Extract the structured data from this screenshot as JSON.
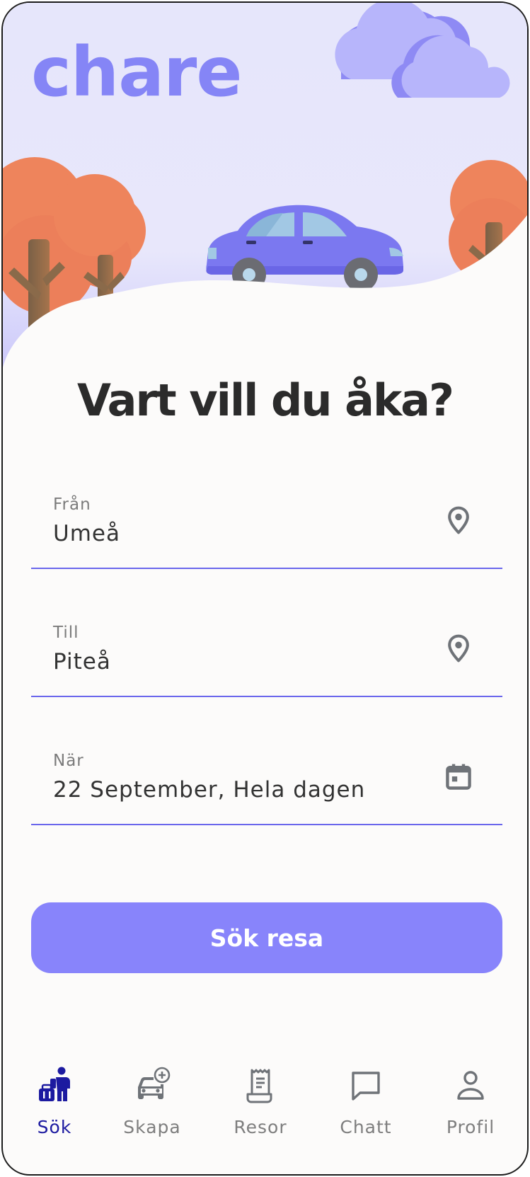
{
  "app": {
    "logo": "chare"
  },
  "search": {
    "title": "Vart vill du åka?",
    "fields": [
      {
        "label": "Från",
        "value": "Umeå",
        "icon": "location-pin-icon"
      },
      {
        "label": "Till",
        "value": "Piteå",
        "icon": "location-pin-icon"
      },
      {
        "label": "När",
        "value": "22 September, Hela dagen",
        "icon": "calendar-icon"
      }
    ],
    "button_label": "Sök resa"
  },
  "tabbar": {
    "active": "Sök",
    "tabs": [
      {
        "label": "Sök",
        "icon": "traveler-luggage-icon"
      },
      {
        "label": "Skapa",
        "icon": "car-plus-icon"
      },
      {
        "label": "Resor",
        "icon": "receipt-icon"
      },
      {
        "label": "Chatt",
        "icon": "chat-bubble-icon"
      },
      {
        "label": "Profil",
        "icon": "person-icon"
      }
    ]
  },
  "colors": {
    "brand": "#8585f6",
    "button": "#8884fb",
    "underline": "#6a66ec",
    "active_tab": "#1c1aa0",
    "inactive_tab": "#7e7e7e",
    "sky": "#e6e6fb",
    "tree": "#ee845c",
    "car": "#7b78f0"
  }
}
